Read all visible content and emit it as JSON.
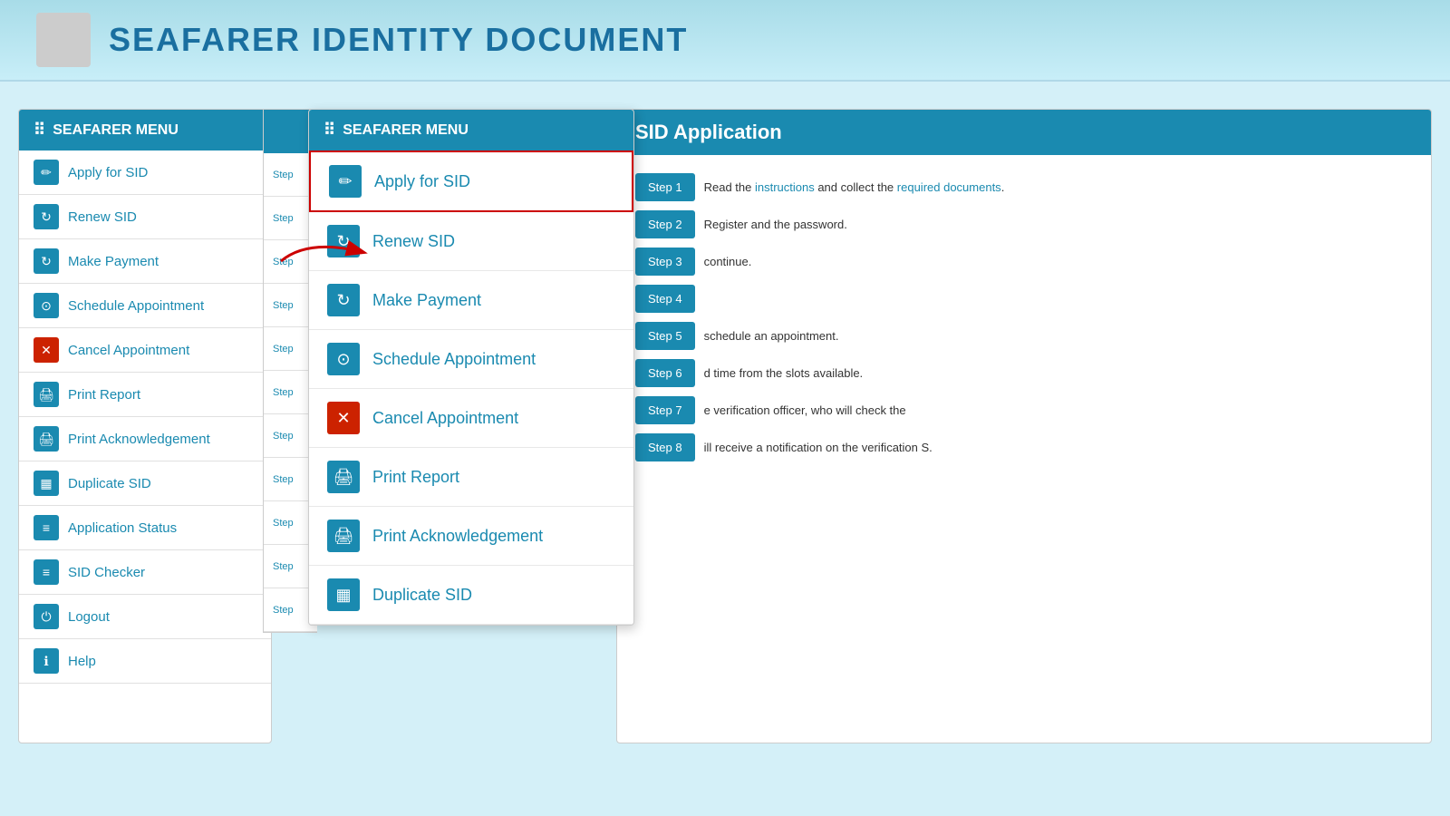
{
  "header": {
    "title": "SEAFARER IDENTITY DOCUMENT"
  },
  "left_sidebar": {
    "menu_header": "SEAFARER MENU",
    "items": [
      {
        "label": "Apply for SID",
        "icon": "✏"
      },
      {
        "label": "Renew SID",
        "icon": "↻"
      },
      {
        "label": "Make Payment",
        "icon": "↻"
      },
      {
        "label": "Schedule Appointment",
        "icon": "⊙"
      },
      {
        "label": "Cancel Appointment",
        "icon": "✕"
      },
      {
        "label": "Print Report",
        "icon": "🖨"
      },
      {
        "label": "Print Acknowledgement",
        "icon": "🖨"
      },
      {
        "label": "Duplicate SID",
        "icon": "▦"
      },
      {
        "label": "Application Status",
        "icon": "≡"
      },
      {
        "label": "SID Checker",
        "icon": "≡"
      },
      {
        "label": "Logout",
        "icon": "⏻"
      },
      {
        "label": "Help",
        "icon": "ℹ"
      }
    ]
  },
  "dropdown_menu": {
    "header": "SEAFARER MENU",
    "items": [
      {
        "label": "Apply for SID",
        "icon": "✏",
        "highlighted": true
      },
      {
        "label": "Renew SID",
        "icon": "↻",
        "highlighted": false
      },
      {
        "label": "Make Payment",
        "icon": "↻",
        "highlighted": false
      },
      {
        "label": "Schedule Appointment",
        "icon": "⊙",
        "highlighted": false
      },
      {
        "label": "Cancel Appointment",
        "icon": "✕",
        "highlighted": false
      },
      {
        "label": "Print Report",
        "icon": "🖨",
        "highlighted": false
      },
      {
        "label": "Print Acknowledgement",
        "icon": "🖨",
        "highlighted": false
      },
      {
        "label": "Duplicate SID",
        "icon": "▦",
        "highlighted": false
      }
    ]
  },
  "content": {
    "header": "SID Application",
    "steps": [
      {
        "btn": "Step 1",
        "text": "Read the instructions and collect the required documents."
      },
      {
        "btn": "Step 2",
        "text": "Register and the password."
      },
      {
        "btn": "Step 3",
        "text": "continue."
      },
      {
        "btn": "Step 4",
        "text": ""
      },
      {
        "btn": "Step 5",
        "text": "schedule an appointment."
      },
      {
        "btn": "Step 6",
        "text": "d time from the slots available."
      },
      {
        "btn": "Step 7",
        "text": "e verification officer, who will check the"
      },
      {
        "btn": "Step 8",
        "text": "ill receive a notification on the verification S."
      }
    ]
  },
  "partial_steps": [
    "Step",
    "Step",
    "Step",
    "Step",
    "Step",
    "Step",
    "Step",
    "Step",
    "Step",
    "Step",
    "Step"
  ]
}
